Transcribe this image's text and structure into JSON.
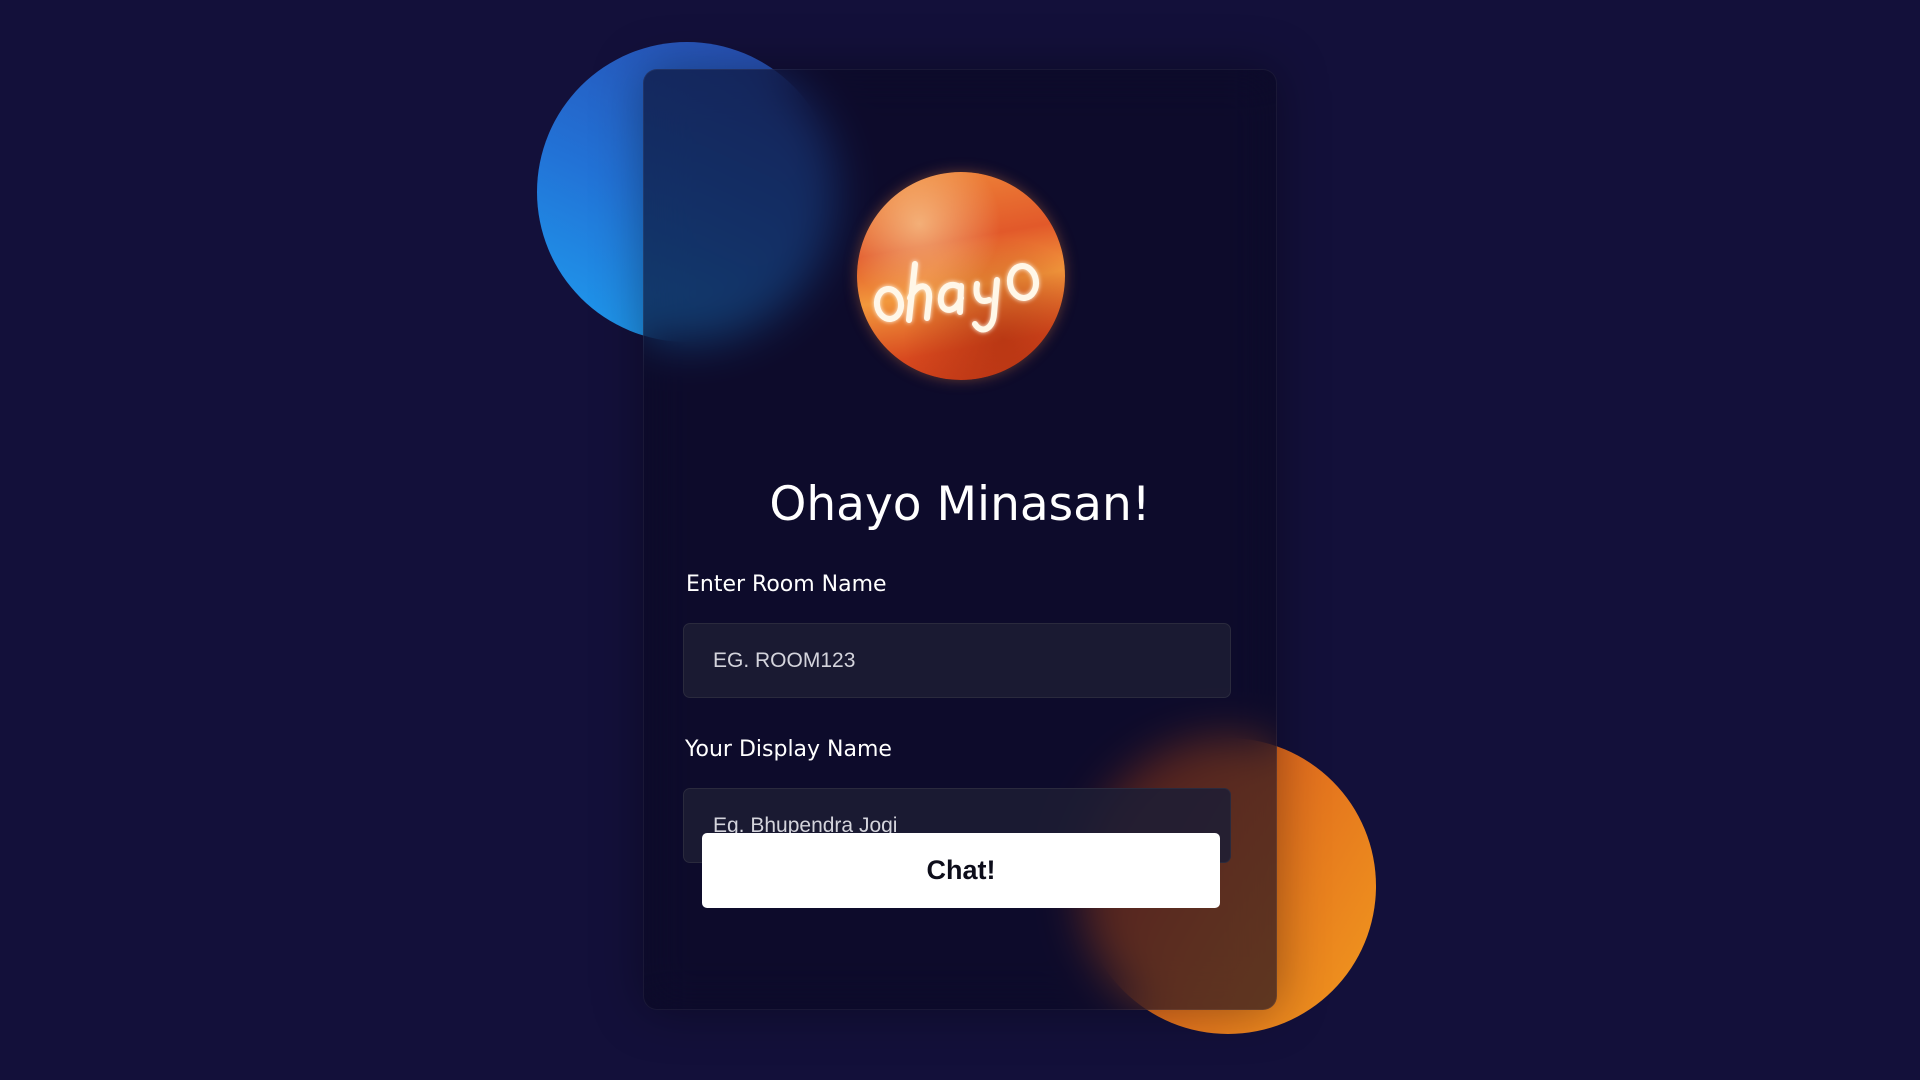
{
  "colors": {
    "background": "#13103a",
    "card": "#0a0822",
    "input_background": "#1e1e34",
    "button_background": "#ffffff",
    "accent_blue": "#2272d6",
    "accent_orange": "#f29a1e"
  },
  "logo": {
    "text": "ohayo",
    "icon": "orange-planet-logo"
  },
  "heading": "Ohayo Minasan!",
  "room": {
    "label": "Enter Room Name",
    "placeholder": "EG. ROOM123",
    "value": ""
  },
  "display_name": {
    "label": "Your Display Name",
    "placeholder": "Eg. Bhupendra Jogi",
    "value": ""
  },
  "submit": {
    "label": "Chat!"
  }
}
